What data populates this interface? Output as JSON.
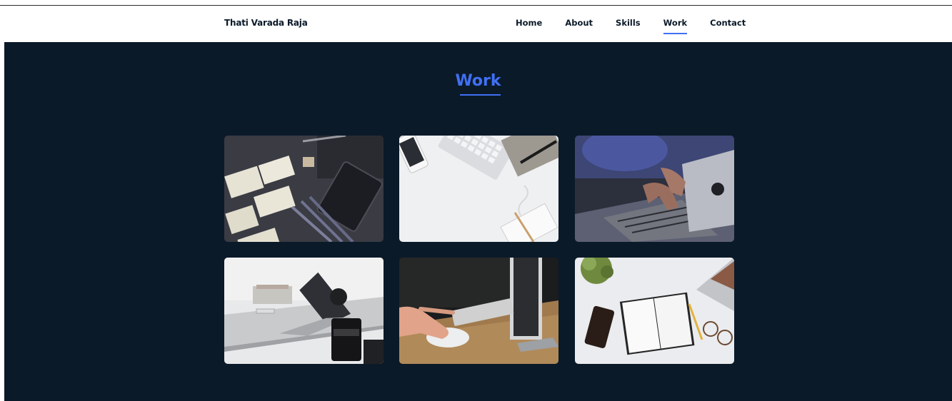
{
  "header": {
    "brand": "Thati Varada Raja",
    "nav": [
      "Home",
      "About",
      "Skills",
      "Work",
      "Contact"
    ],
    "active_nav": "Work"
  },
  "work": {
    "title": "Work",
    "projects": [
      {
        "image": "desk-with-sketches-and-tablet"
      },
      {
        "image": "keyboard-phone-notebook-on-white-desk"
      },
      {
        "image": "hands-typing-on-laptop"
      },
      {
        "image": "laptop-on-desk-with-camera-lens"
      },
      {
        "image": "hand-using-mouse-at-wooden-desk"
      },
      {
        "image": "open-notebook-phone-glasses-top-view"
      }
    ]
  },
  "colors": {
    "accent": "#4070f4",
    "background": "#0b1a29"
  }
}
